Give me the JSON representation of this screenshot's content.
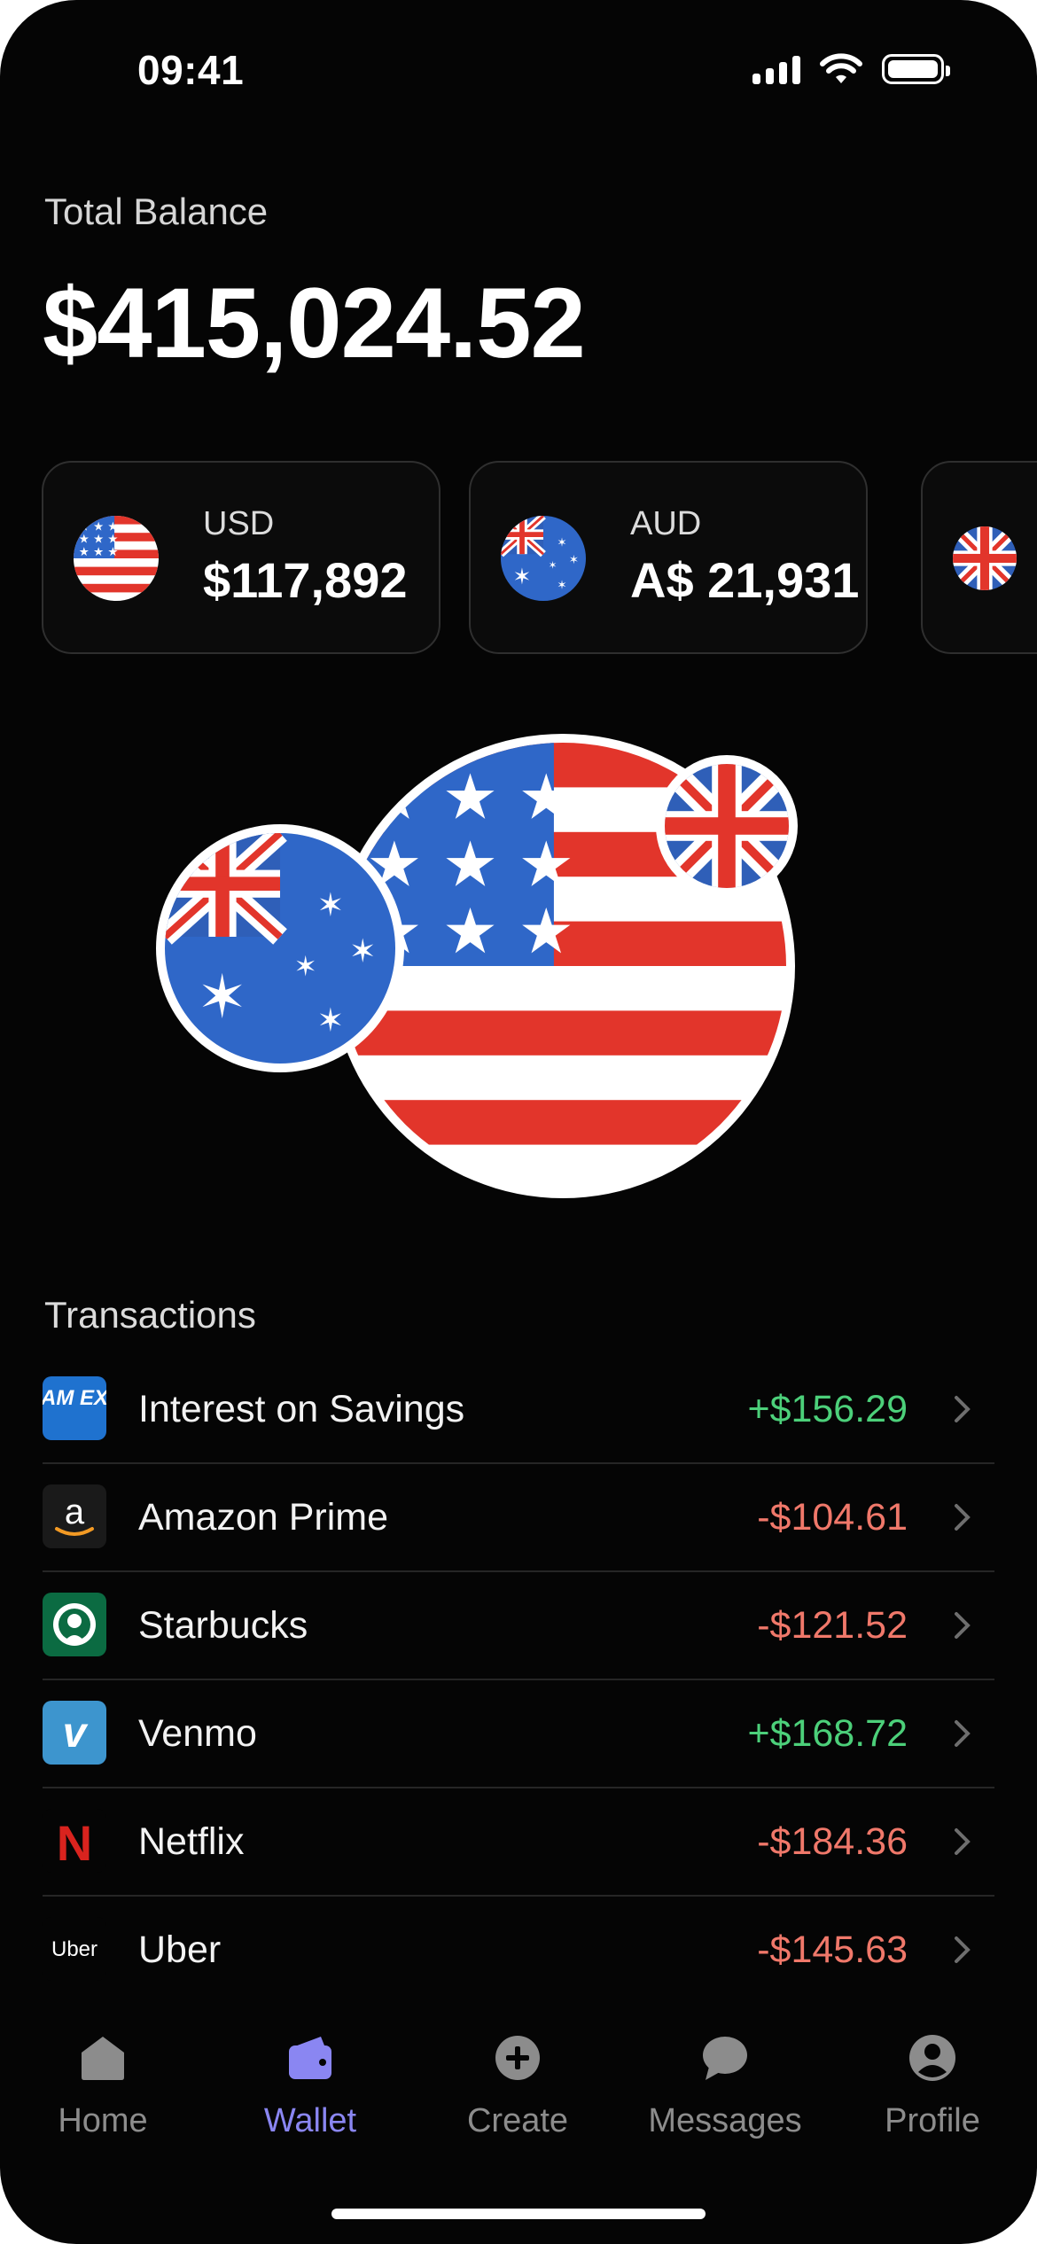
{
  "status_bar": {
    "time": "09:41"
  },
  "balance": {
    "label": "Total Balance",
    "amount": "$415,024.52"
  },
  "currencies": [
    {
      "code": "USD",
      "amount": "$117,892",
      "flag": "us-flag"
    },
    {
      "code": "AUD",
      "amount": "A$ 21,931",
      "flag": "au-flag"
    },
    {
      "code": "",
      "amount": "",
      "flag": "uk-flag"
    }
  ],
  "transactions": {
    "title": "Transactions",
    "items": [
      {
        "name": "Interest on Savings",
        "amount": "+$156.29",
        "logo": "amex-logo",
        "positive": true
      },
      {
        "name": "Amazon Prime",
        "amount": "-$104.61",
        "logo": "amazon-logo",
        "positive": false
      },
      {
        "name": "Starbucks",
        "amount": "-$121.52",
        "logo": "starbucks-logo",
        "positive": false
      },
      {
        "name": "Venmo",
        "amount": "+$168.72",
        "logo": "venmo-logo",
        "positive": true
      },
      {
        "name": "Netflix",
        "amount": "-$184.36",
        "logo": "netflix-logo",
        "positive": false
      },
      {
        "name": "Uber",
        "amount": "-$145.63",
        "logo": "uber-logo",
        "positive": false
      }
    ],
    "logo_texts": {
      "amex": "AM EX",
      "amazon": "a",
      "venmo": "v",
      "netflix": "N",
      "uber": "Uber"
    }
  },
  "tabbar": {
    "items": [
      {
        "label": "Home",
        "icon": "home-icon"
      },
      {
        "label": "Wallet",
        "icon": "wallet-icon"
      },
      {
        "label": "Create",
        "icon": "plus-circle-icon"
      },
      {
        "label": "Messages",
        "icon": "chat-bubble-icon"
      },
      {
        "label": "Profile",
        "icon": "profile-icon"
      }
    ],
    "active": "Wallet"
  },
  "colors": {
    "accent": "#8a86f2",
    "positive": "#4cd07a",
    "negative": "#f0786a",
    "background": "#050505"
  }
}
